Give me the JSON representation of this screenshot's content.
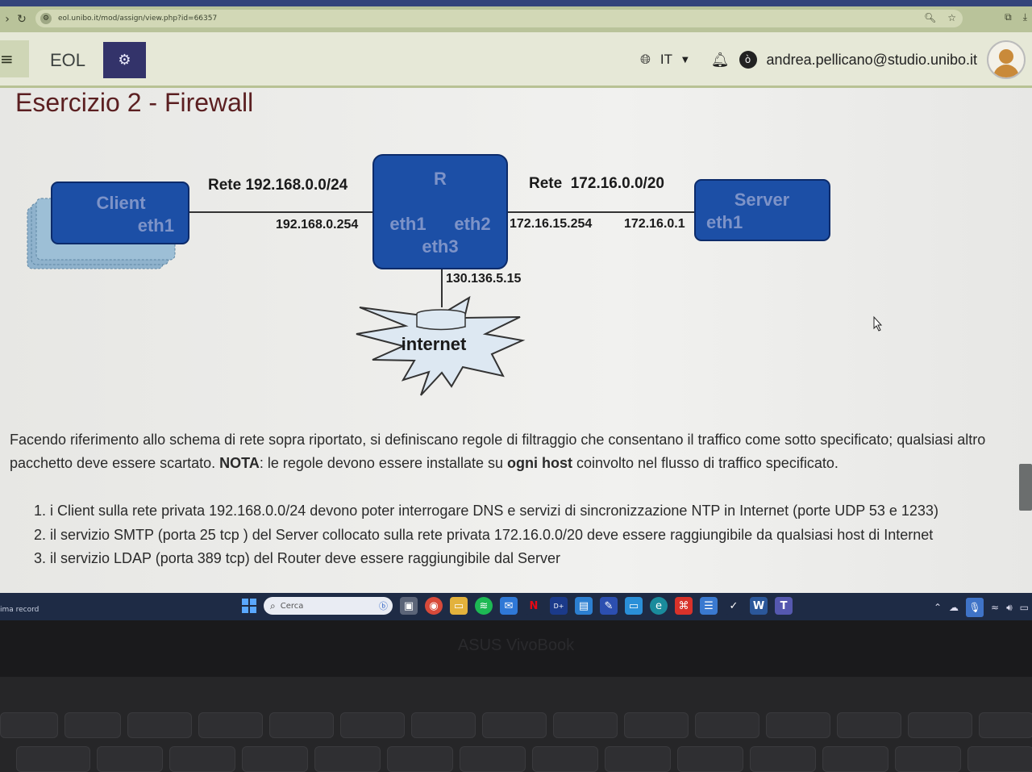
{
  "browser": {
    "url": "eol.unibo.it/mod/assign/view.php?id=66357",
    "nav": {
      "back": "›",
      "reload": "↻"
    }
  },
  "header": {
    "brand": "EOL",
    "lang": "IT",
    "user_email": "andrea.pellicano@studio.unibo.it"
  },
  "page": {
    "title": "Esercizio 2 - Firewall",
    "diagram": {
      "client_label": "Client",
      "client_iface": "eth1",
      "net_left": "Rete 192.168.0.0/24",
      "router_label": "R",
      "router_eth1": "eth1",
      "router_eth2": "eth2",
      "router_eth3": "eth3",
      "ip_left": "192.168.0.254",
      "net_right": "Rete  172.16.0.0/20",
      "ip_right_router": "172.16.15.254",
      "ip_server": "172.16.0.1",
      "server_label": "Server",
      "server_iface": "eth1",
      "ip_internet": "130.136.5.15",
      "internet_label": "internet"
    },
    "description": {
      "part1": "Facendo riferimento allo schema di rete sopra riportato, si definiscano regole di filtraggio che consentano il traffico come sotto specificato; qualsiasi altro pacchetto deve essere scartato. ",
      "nota": "NOTA",
      "part2": ": le regole devono essere installate su ",
      "ogni_host": "ogni host",
      "part3": " coinvolto nel flusso di traffico specificato."
    },
    "requirements": [
      "1. i Client sulla rete privata 192.168.0.0/24 devono poter interrogare DNS e servizi di sincronizzazione NTP in Internet (porte UDP 53 e 1233)",
      "2. il servizio SMTP (porta 25 tcp ) del Server collocato sulla rete privata 172.16.0.0/20 deve essere raggiungibile da qualsiasi host di Internet",
      "3. il servizio LDAP (porta 389 tcp) del Router deve essere raggiungibile dal Server"
    ]
  },
  "taskbar": {
    "left_text": "ima record",
    "search_placeholder": "Cerca"
  },
  "laptop": {
    "brand": "ASUS VivoBook"
  },
  "colors": {
    "node_fill": "#1c4fa6",
    "node_text": "#7d93c8",
    "title": "#5b1f21",
    "admin_btn": "#33336a"
  }
}
